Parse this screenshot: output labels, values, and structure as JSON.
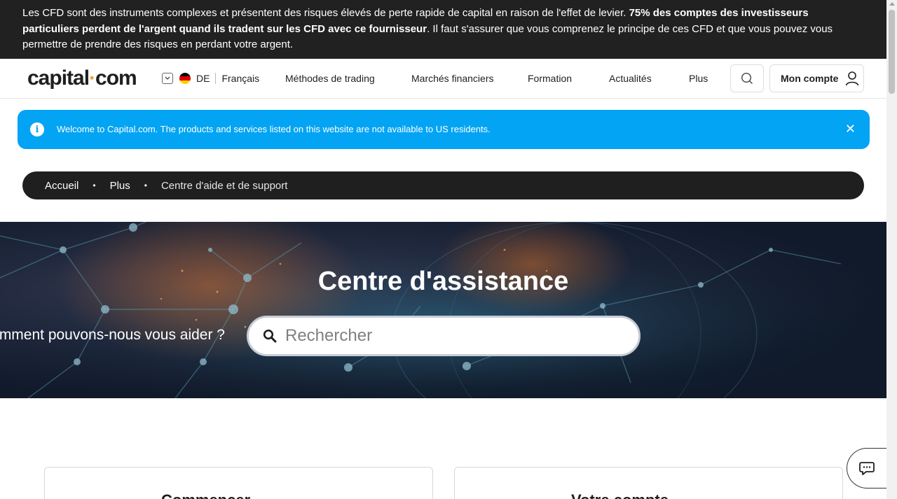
{
  "risk_banner": {
    "part1": "Les CFD sont des instruments complexes et présentent des risques élevés de perte rapide de capital en raison de l'effet de levier. ",
    "bold": "75% des comptes des investisseurs particuliers perdent de l'argent quand ils tradent sur les CFD avec ce fournisseur",
    "part2": ". Il faut s'assurer que vous comprenez le principe de ces CFD et que vous pouvez vous permettre de prendre des risques en perdant votre argent."
  },
  "header": {
    "logo_a": "capital",
    "logo_dot": "·",
    "logo_b": "com",
    "country": "DE",
    "language": "Français",
    "nav": [
      "Méthodes de trading",
      "Marchés financiers",
      "Formation",
      "Actualités",
      "Plus"
    ],
    "account_label": "Mon compte"
  },
  "notice": {
    "text": "Welcome to Capital.com. The products and services listed on this website are not available to US residents.",
    "info_glyph": "i",
    "close_glyph": "✕"
  },
  "breadcrumb": {
    "items": [
      "Accueil",
      "Plus",
      "Centre d'aide et de support"
    ],
    "bullet": "•"
  },
  "hero": {
    "title": "Centre d'assistance",
    "question": "Comment pouvons-nous vous aider ?",
    "search_placeholder": "Rechercher"
  },
  "cards": [
    "Commencer",
    "Votre compte"
  ],
  "colors": {
    "accent": "#03a4f3",
    "dark": "#1f1f1f",
    "logo_dot": "#e8a040"
  },
  "icons": [
    "search-icon",
    "user-icon",
    "info-icon",
    "close-icon",
    "chat-icon",
    "flag-de-icon",
    "chevron-down-icon"
  ]
}
